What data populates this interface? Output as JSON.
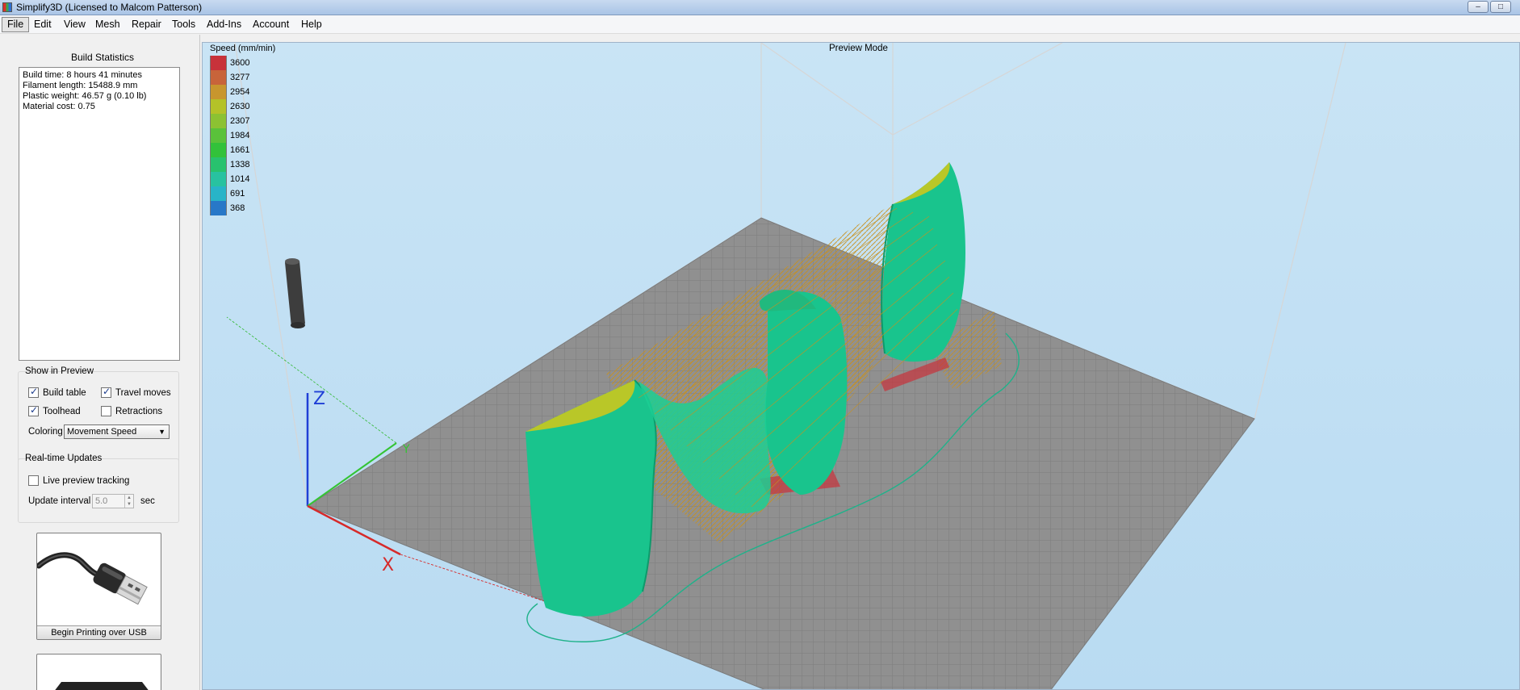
{
  "window": {
    "title": "Simplify3D (Licensed to Malcom Patterson)"
  },
  "menu": [
    "File",
    "Edit",
    "View",
    "Mesh",
    "Repair",
    "Tools",
    "Add-Ins",
    "Account",
    "Help"
  ],
  "build_statistics": {
    "heading": "Build Statistics",
    "lines": [
      "Build time: 8 hours 41 minutes",
      "Filament length: 15488.9 mm",
      "Plastic weight: 46.57 g (0.10 lb)",
      "Material cost: 0.75"
    ]
  },
  "show_in_preview": {
    "heading": "Show in Preview",
    "build_table": {
      "label": "Build table",
      "checked": true
    },
    "travel_moves": {
      "label": "Travel moves",
      "checked": true
    },
    "toolhead": {
      "label": "Toolhead",
      "checked": true
    },
    "retractions": {
      "label": "Retractions",
      "checked": false
    },
    "coloring_label": "Coloring",
    "coloring_value": "Movement Speed"
  },
  "realtime_updates": {
    "heading": "Real-time Updates",
    "live_tracking": {
      "label": "Live preview tracking",
      "checked": false
    },
    "interval_label": "Update interval",
    "interval_value": "5.0",
    "interval_unit": "sec"
  },
  "buttons": {
    "usb": "Begin Printing over USB"
  },
  "viewport": {
    "mode_label": "Preview Mode",
    "legend_title": "Speed (mm/min)",
    "legend": [
      {
        "label": "3600",
        "color": "#c8323a"
      },
      {
        "label": "3277",
        "color": "#c8643a"
      },
      {
        "label": "2954",
        "color": "#c8962e"
      },
      {
        "label": "2630",
        "color": "#b4c228"
      },
      {
        "label": "2307",
        "color": "#8cc232"
      },
      {
        "label": "1984",
        "color": "#5ac23a"
      },
      {
        "label": "1661",
        "color": "#32c23a"
      },
      {
        "label": "1338",
        "color": "#28c26e"
      },
      {
        "label": "1014",
        "color": "#28c2a0"
      },
      {
        "label": "691",
        "color": "#28b4c8"
      },
      {
        "label": "368",
        "color": "#2878c8"
      }
    ],
    "axis_labels": {
      "x": "X",
      "y": "Y",
      "z": "Z"
    }
  },
  "icons": [
    "usb-cable-icon",
    "sd-card-icon",
    "minimize-icon",
    "maximize-icon",
    "close-icon"
  ]
}
